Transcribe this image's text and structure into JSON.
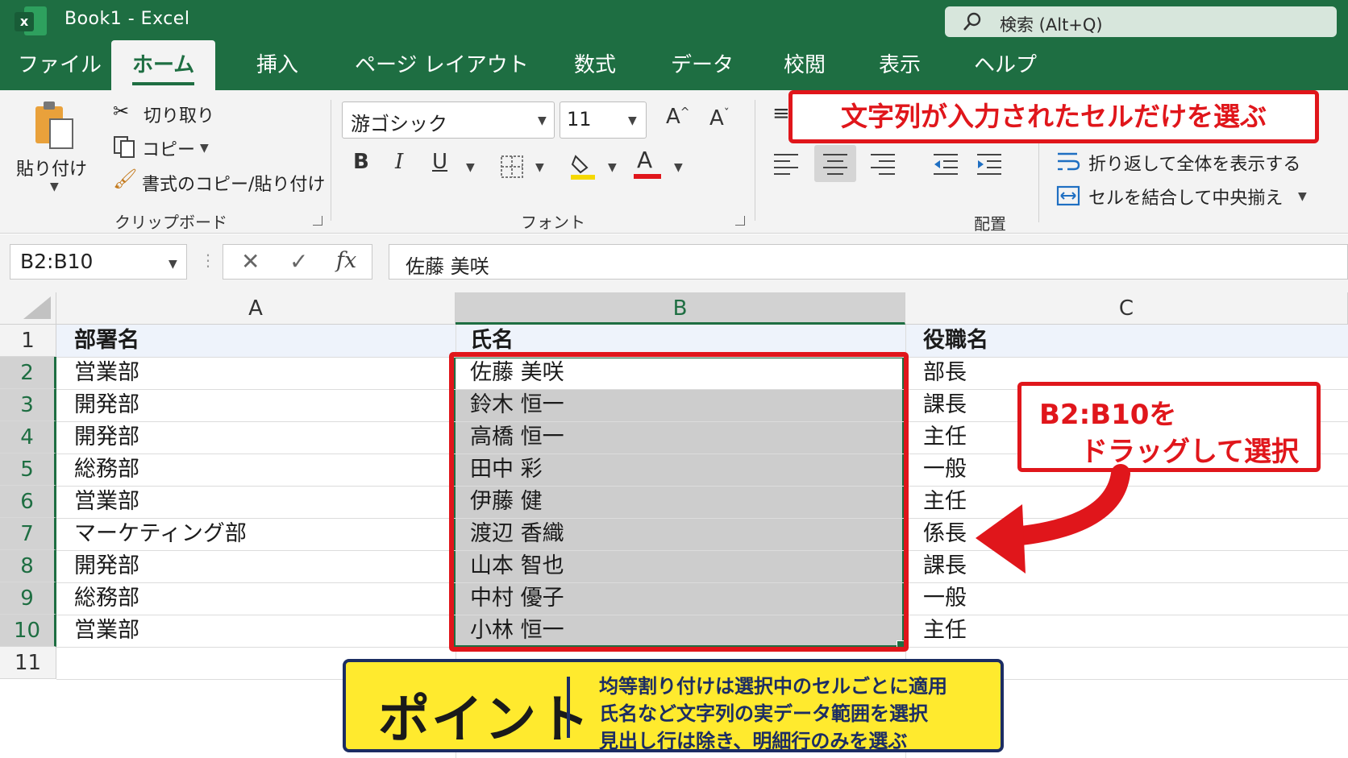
{
  "titlebar": {
    "app_title": "Book1  -  Excel",
    "search_placeholder": "検索 (Alt+Q)"
  },
  "tabs": [
    "ファイル",
    "ホーム",
    "挿入",
    "ページ レイアウト",
    "数式",
    "データ",
    "校閲",
    "表示",
    "ヘルプ"
  ],
  "active_tab": "ホーム",
  "ribbon": {
    "paste_label": "貼り付け",
    "cut_label": "切り取り",
    "copy_label": "コピー",
    "format_painter_label": "書式のコピー/貼り付け",
    "clipboard_group": "クリップボード",
    "font_name": "游ゴシック",
    "font_size": "11",
    "font_group": "フォント",
    "wrap_text_label": "折り返して全体を表示する",
    "merge_center_label": "セルを結合して中央揃え",
    "alignment_group": "配置"
  },
  "formula_bar": {
    "name_box": "B2:B10",
    "formula": "佐藤 美咲"
  },
  "sheet": {
    "columns": [
      "A",
      "B",
      "C"
    ],
    "rows": [
      "1",
      "2",
      "3",
      "4",
      "5",
      "6",
      "7",
      "8",
      "9",
      "10",
      "11"
    ],
    "headers": [
      "部署名",
      "氏名",
      "役職名"
    ],
    "data": [
      [
        "営業部",
        "佐藤 美咲",
        "部長"
      ],
      [
        "開発部",
        "鈴木 恒一",
        "課長"
      ],
      [
        "開発部",
        "高橋 恒一",
        "主任"
      ],
      [
        "総務部",
        "田中 彩",
        "一般"
      ],
      [
        "営業部",
        "伊藤 健",
        "主任"
      ],
      [
        "マーケティング部",
        "渡辺 香織",
        "係長"
      ],
      [
        "開発部",
        "山本 智也",
        "課長"
      ],
      [
        "総務部",
        "中村 優子",
        "一般"
      ],
      [
        "営業部",
        "小林 恒一",
        "主任"
      ]
    ]
  },
  "annotations": {
    "top_callout": "文字列が入力されたセルだけを選ぶ",
    "right_callout_line1": "B2:B10を",
    "right_callout_line2": "ドラッグして選択",
    "point_title": "ポイント",
    "point_lines": [
      "均等割り付けは選択中のセルごとに適用",
      "氏名など文字列の実データ範囲を選択",
      "見出し行は除き、明細行のみを選ぶ"
    ]
  },
  "colors": {
    "excel_green": "#1e6e42",
    "callout_red": "#e0161b",
    "point_yellow": "#ffea2e",
    "point_navy": "#1c2d63"
  }
}
